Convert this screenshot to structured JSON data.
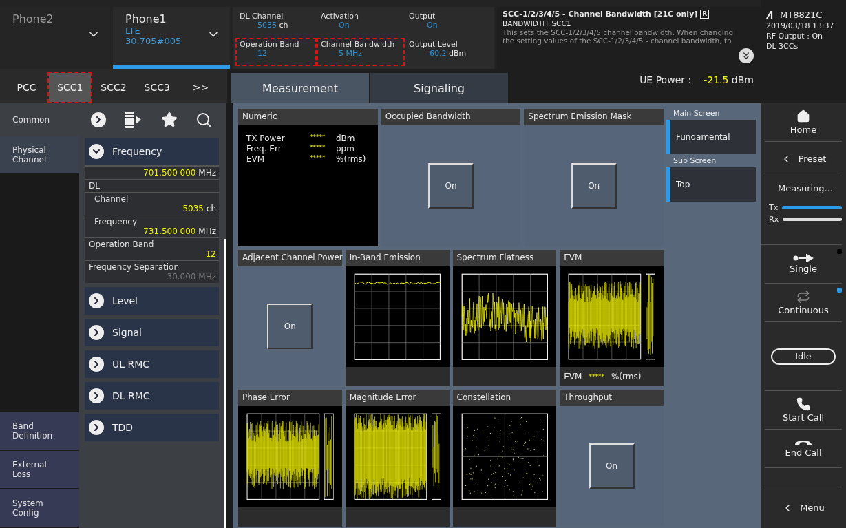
{
  "phones": [
    {
      "name": "Phone2",
      "selected": false
    },
    {
      "name": "Phone1",
      "selected": true,
      "mode": "LTE",
      "detail": "30.705#005"
    }
  ],
  "status_params": [
    {
      "label": "DL Channel",
      "value": "5035",
      "unit": "ch",
      "highlighted": false
    },
    {
      "label": "Activation",
      "value": "On",
      "highlighted": false
    },
    {
      "label": "Output",
      "value": "On",
      "highlighted": false
    },
    {
      "label": "Operation Band",
      "value": "12",
      "highlighted": true
    },
    {
      "label": "Channel Bandwidth",
      "value": "5 MHz",
      "highlighted": true
    },
    {
      "label": "Output Level",
      "value": "-60.2",
      "unit": "dBm",
      "highlighted": false
    }
  ],
  "help": {
    "title": "SCC-1/2/3/4/5 - Channel Bandwidth [21C only]",
    "badge": "R",
    "command": "BANDWIDTH_SCC1",
    "text": "This sets the SCC-1/2/3/4/5 channel bandwidth. When changing the setting values of the SCC-1/2/3/4/5 - channel bandwidth, th"
  },
  "device": {
    "model": "MT8821C",
    "datetime": "2019/03/18 13:37",
    "rf_output": "RF Output : On",
    "carriers": "DL 3CCs"
  },
  "cc_tabs": [
    {
      "label": "PCC",
      "selected": false,
      "highlighted": false
    },
    {
      "label": "SCC1",
      "selected": true,
      "highlighted": true
    },
    {
      "label": "SCC2",
      "selected": false,
      "highlighted": false
    },
    {
      "label": "SCC3",
      "selected": false,
      "highlighted": false
    },
    {
      "label": ">>",
      "selected": false,
      "highlighted": false
    }
  ],
  "view_tabs": [
    {
      "label": "Measurement",
      "selected": true
    },
    {
      "label": "Signaling",
      "selected": false
    }
  ],
  "ue_power": {
    "label": "UE Power :",
    "value": "-21.5",
    "unit": "dBm"
  },
  "nav": [
    {
      "label": "Common",
      "selected": false
    },
    {
      "label": "Physical Channel",
      "selected": true
    },
    {
      "label": "Band Definition",
      "selected": false
    },
    {
      "label": "External Loss",
      "selected": false
    },
    {
      "label": "System Config",
      "selected": false
    }
  ],
  "param_sections": [
    {
      "title": "Frequency",
      "expanded": true,
      "fields": [
        {
          "kind": "group",
          "children": [
            {
              "kind": "field",
              "value": "701.500 000",
              "unit": "MHz",
              "disabled": false
            }
          ]
        },
        {
          "kind": "group",
          "label": "DL",
          "children": [
            {
              "kind": "field",
              "label": "Channel",
              "value": "5035",
              "unit": "ch",
              "disabled": false
            },
            {
              "kind": "field",
              "label": "Frequency",
              "value": "731.500 000",
              "unit": "MHz",
              "disabled": false
            }
          ]
        },
        {
          "kind": "field",
          "label": "Operation Band",
          "value": "12",
          "disabled": false
        },
        {
          "kind": "field",
          "label": "Frequency Separation",
          "value": "30.000",
          "unit": "MHz",
          "disabled": true
        }
      ]
    },
    {
      "title": "Level",
      "expanded": false
    },
    {
      "title": "Signal",
      "expanded": false
    },
    {
      "title": "UL RMC",
      "expanded": false
    },
    {
      "title": "DL RMC",
      "expanded": false
    },
    {
      "title": "TDD",
      "expanded": false
    }
  ],
  "measurements": [
    {
      "kind": "numeric",
      "title": "Numeric",
      "rows": [
        {
          "label": "TX Power",
          "value": "*****",
          "unit": "dBm"
        },
        {
          "label": "Freq. Err",
          "value": "*****",
          "unit": "ppm"
        },
        {
          "label": "EVM",
          "value": "*****",
          "unit": "%(rms)"
        }
      ]
    },
    {
      "kind": "toggle",
      "title": "Occupied Bandwidth",
      "button": "On"
    },
    {
      "kind": "toggle",
      "title": "Spectrum Emission Mask",
      "button": "On"
    },
    {
      "kind": "toggle",
      "title": "Adjacent Channel Power",
      "button": "On"
    },
    {
      "kind": "line",
      "title": "In-Band Emission"
    },
    {
      "kind": "noise",
      "title": "Spectrum Flatness"
    },
    {
      "kind": "bars",
      "title": "EVM",
      "footer": {
        "label": "EVM",
        "value": "*****",
        "unit": "%(rms)"
      }
    },
    {
      "kind": "bars",
      "title": "Phase Error"
    },
    {
      "kind": "dense",
      "title": "Magnitude Error"
    },
    {
      "kind": "scatter",
      "title": "Constellation"
    },
    {
      "kind": "toggle",
      "title": "Throughput",
      "button": "On"
    }
  ],
  "screens": [
    {
      "heading": "Main Screen",
      "value": "Fundamental"
    },
    {
      "heading": "Sub Screen",
      "value": "Top"
    }
  ],
  "side_buttons": [
    {
      "kind": "home",
      "label": "Home"
    },
    {
      "kind": "back",
      "label": "Preset"
    },
    {
      "kind": "status",
      "label": "Measuring...",
      "meters": [
        {
          "label": "Tx",
          "level": 1,
          "active": true
        },
        {
          "label": "Rx",
          "level": 1,
          "active": false
        }
      ]
    },
    {
      "kind": "single",
      "label": "Single",
      "selected": false
    },
    {
      "kind": "continuous",
      "label": "Continuous",
      "selected": true
    },
    {
      "kind": "pill",
      "label": "Idle"
    },
    {
      "kind": "call",
      "label": "Start Call"
    },
    {
      "kind": "hangup",
      "label": "End Call"
    },
    {
      "kind": "back",
      "label": "Menu"
    }
  ]
}
